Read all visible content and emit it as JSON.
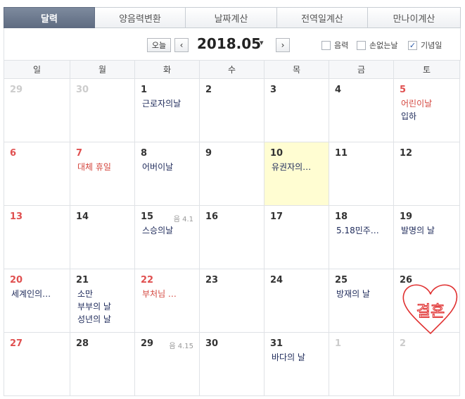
{
  "tabs": [
    {
      "label": "달력",
      "active": true
    },
    {
      "label": "양음력변환",
      "active": false
    },
    {
      "label": "날짜계산",
      "active": false
    },
    {
      "label": "전역일계산",
      "active": false
    },
    {
      "label": "만나이계산",
      "active": false
    }
  ],
  "toolbar": {
    "today_label": "오늘",
    "prev_icon": "‹",
    "next_icon": "›",
    "month": "2018.05",
    "month_caret": "▾",
    "checkboxes": {
      "lunar": {
        "label": "음력",
        "checked": false
      },
      "noloss": {
        "label": "손없는날",
        "checked": false
      },
      "memorial": {
        "label": "기념일",
        "checked": true,
        "mark": "✓"
      }
    }
  },
  "weekdays": [
    "일",
    "월",
    "화",
    "수",
    "목",
    "금",
    "토"
  ],
  "colors": {
    "holiday_red": "#e05050",
    "event_navy": "#1e2a5a",
    "today_bg": "#fffdd2",
    "active_tab": "#6b788e",
    "stamp_red": "#e03030"
  },
  "weeks": [
    [
      {
        "num": "29",
        "other": true
      },
      {
        "num": "30",
        "other": true
      },
      {
        "num": "1",
        "events": [
          {
            "text": "근로자의날"
          }
        ]
      },
      {
        "num": "2"
      },
      {
        "num": "3"
      },
      {
        "num": "4"
      },
      {
        "num": "5",
        "red": true,
        "events": [
          {
            "text": "어린이날",
            "holiday": true
          },
          {
            "text": "입하"
          }
        ]
      }
    ],
    [
      {
        "num": "6",
        "red": true
      },
      {
        "num": "7",
        "red": true,
        "events": [
          {
            "text": "대체 휴일",
            "holiday": true
          }
        ]
      },
      {
        "num": "8",
        "events": [
          {
            "text": "어버이날"
          }
        ]
      },
      {
        "num": "9"
      },
      {
        "num": "10",
        "today": true,
        "events": [
          {
            "text": "유권자의…"
          }
        ]
      },
      {
        "num": "11"
      },
      {
        "num": "12"
      }
    ],
    [
      {
        "num": "13",
        "red": true
      },
      {
        "num": "14"
      },
      {
        "num": "15",
        "lunar": "음 4.1",
        "events": [
          {
            "text": "스승의날"
          }
        ]
      },
      {
        "num": "16"
      },
      {
        "num": "17"
      },
      {
        "num": "18",
        "events": [
          {
            "text": "5.18민주…"
          }
        ]
      },
      {
        "num": "19",
        "events": [
          {
            "text": "발명의 날"
          }
        ]
      }
    ],
    [
      {
        "num": "20",
        "red": true,
        "events": [
          {
            "text": "세계인의…"
          }
        ]
      },
      {
        "num": "21",
        "events": [
          {
            "text": "소만"
          },
          {
            "text": "부부의 날"
          },
          {
            "text": "성년의 날"
          }
        ]
      },
      {
        "num": "22",
        "red": true,
        "events": [
          {
            "text": "부처님 …",
            "holiday": true
          }
        ]
      },
      {
        "num": "23"
      },
      {
        "num": "24"
      },
      {
        "num": "25",
        "events": [
          {
            "text": "방재의 날"
          }
        ]
      },
      {
        "num": "26"
      }
    ],
    [
      {
        "num": "27",
        "red": true
      },
      {
        "num": "28"
      },
      {
        "num": "29",
        "lunar": "음 4.15"
      },
      {
        "num": "30"
      },
      {
        "num": "31",
        "events": [
          {
            "text": "바다의 날"
          }
        ]
      },
      {
        "num": "1",
        "other": true
      },
      {
        "num": "2",
        "other": true
      }
    ]
  ],
  "stamp": {
    "text": "결혼",
    "shape": "heart-icon"
  }
}
